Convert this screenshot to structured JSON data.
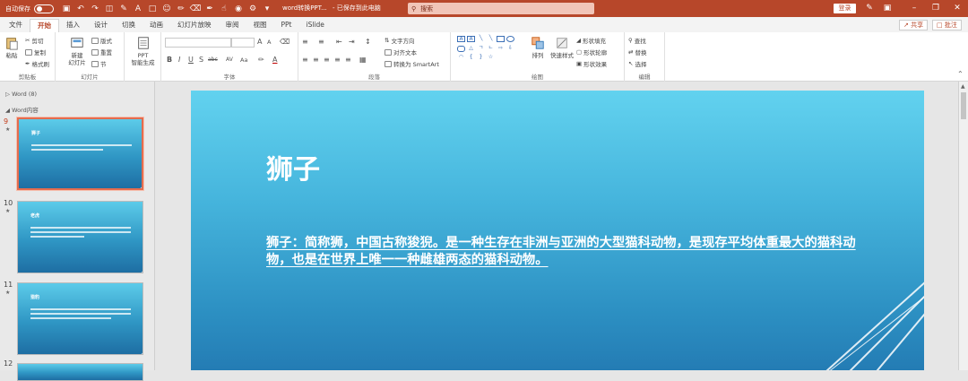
{
  "titlebar": {
    "autosave_label": "自动保存",
    "toggle_state": "关",
    "doc_title": "word转换PPT...",
    "save_status": "- 已保存到此电脑",
    "search_placeholder": "搜索",
    "login_label": "登录",
    "accent_color": "#b7472a"
  },
  "menu": {
    "tabs": [
      "文件",
      "开始",
      "插入",
      "设计",
      "切换",
      "动画",
      "幻灯片放映",
      "审阅",
      "视图",
      "PPt",
      "iSlide"
    ],
    "active_tab": "开始",
    "share_label": "共享",
    "comment_label": "批注"
  },
  "ribbon": {
    "clipboard": {
      "paste": "粘贴",
      "cut": "剪切",
      "copy": "复制",
      "format_painter": "格式刷",
      "label": "剪贴板"
    },
    "slides": {
      "new_slide": "新建",
      "new_slide_2": "幻灯片",
      "layout": "版式",
      "reset": "重置",
      "section": "节",
      "label": "幻灯片"
    },
    "ppt_tool": {
      "line1": "PPT",
      "line2": "智能生成"
    },
    "font": {
      "label": "字体",
      "size_up": "A",
      "size_down": "A",
      "bold": "B",
      "italic": "I",
      "underline": "U",
      "strike": "S",
      "shadow": "abc",
      "spacing": "AV",
      "case": "Aa",
      "color": "A"
    },
    "paragraph": {
      "text_direction": "文字方向",
      "align_text": "对齐文本",
      "smartart": "转换为 SmartArt",
      "label": "段落"
    },
    "drawing": {
      "arrange": "排列",
      "quick_styles": "快速样式",
      "shape_fill": "形状填充",
      "shape_outline": "形状轮廓",
      "shape_effects": "形状效果",
      "label": "绘图"
    },
    "editing": {
      "find": "查找",
      "replace": "替换",
      "select": "选择",
      "label": "编辑"
    }
  },
  "slides_panel": {
    "sections": [
      "Word (8)",
      "Word内容"
    ],
    "slides": [
      {
        "number": "9",
        "title": "狮子",
        "selected": true
      },
      {
        "number": "10",
        "title": "老虎",
        "selected": false
      },
      {
        "number": "11",
        "title": "猎豹",
        "selected": false
      },
      {
        "number": "12",
        "title": "",
        "selected": false
      }
    ]
  },
  "current_slide": {
    "title": "狮子",
    "body": "狮子：简称狮，中国古称狻猊。是一种生存在非洲与亚洲的大型猫科动物，是现存平均体重最大的猫科动物，也是在世界上唯一一种雌雄两态的猫科动物。"
  }
}
